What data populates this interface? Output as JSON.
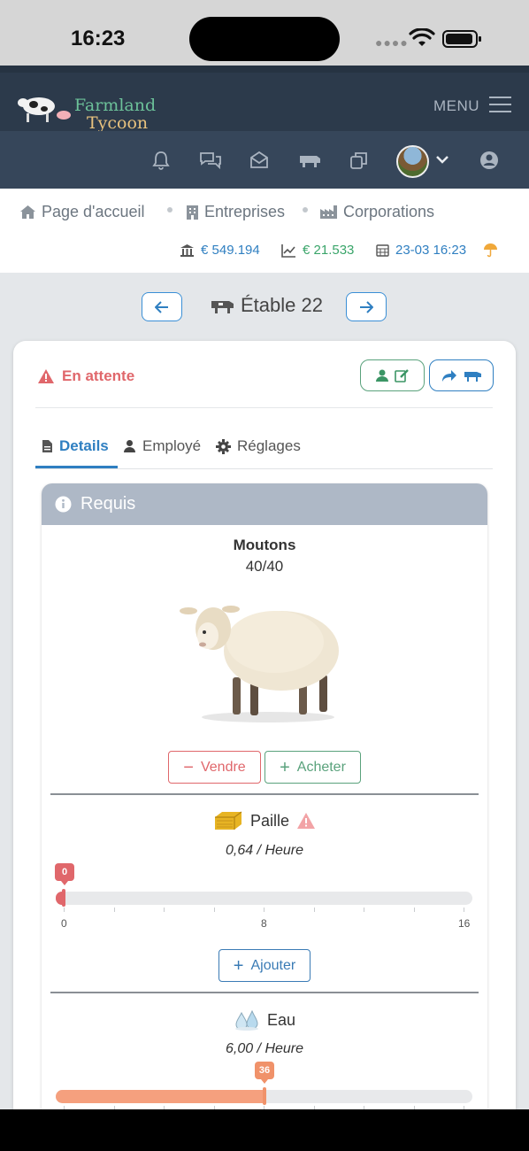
{
  "status_bar": {
    "time": "16:23"
  },
  "navbar": {
    "logo_line1": "Farmland",
    "logo_line2": "Tycoon",
    "menu_label": "MENU"
  },
  "icon_bar": [
    "bell-icon",
    "chat-icon",
    "envelope-icon",
    "cow-icon",
    "copy-icon",
    "avatar",
    "chevron-down-icon",
    "user-circle-icon"
  ],
  "breadcrumbs": [
    {
      "label": "Page d'accueil",
      "icon": "home-icon"
    },
    {
      "label": "Entreprises",
      "icon": "building-icon"
    },
    {
      "label": "Corporations",
      "icon": "industry-icon"
    }
  ],
  "stats": {
    "bank": "€ 549.194",
    "income": "€ 21.533",
    "datetime": "23-03 16:23",
    "weather_icon": "umbrella-icon"
  },
  "page": {
    "title": "Étable 22"
  },
  "card": {
    "status": "En attente",
    "tabs": [
      {
        "label": "Details",
        "active": true
      },
      {
        "label": "Employé",
        "active": false
      },
      {
        "label": "Réglages",
        "active": false
      }
    ]
  },
  "panel": {
    "title": "Requis",
    "animal": {
      "name": "Moutons",
      "count": "40/40"
    },
    "sell_label": "Vendre",
    "buy_label": "Acheter",
    "straw": {
      "name": "Paille",
      "rate": "0,64 / Heure",
      "value": 0,
      "value_label": "0",
      "max": 16,
      "ticks": [
        "0",
        "8",
        "16"
      ],
      "add_label": "Ajouter"
    },
    "water": {
      "name": "Eau",
      "rate": "6,00 / Heure",
      "value": 36,
      "value_label": "36",
      "fill_fraction": 0.5
    }
  },
  "colors": {
    "accent": "#2f7fc1",
    "warning": "#e0676b",
    "success": "#5aa27c",
    "water_fill": "#f5a07e",
    "water_bubble": "#f0926a"
  }
}
